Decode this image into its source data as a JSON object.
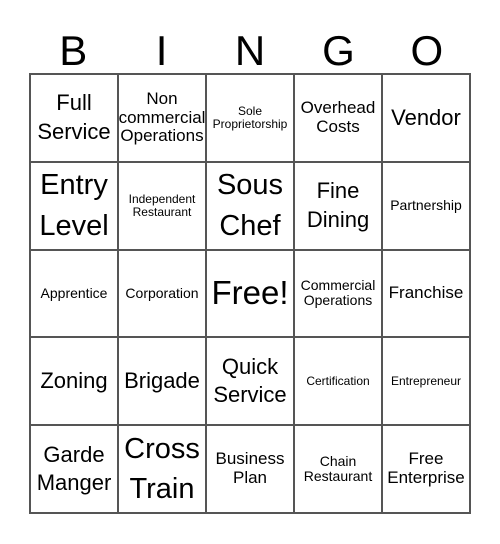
{
  "header": [
    "B",
    "I",
    "N",
    "G",
    "O"
  ],
  "cells": [
    {
      "text": "Full Service",
      "size": "s-lg"
    },
    {
      "text": "Non commercial Operations",
      "size": "s-md"
    },
    {
      "text": "Sole Proprietorship",
      "size": "s-xs"
    },
    {
      "text": "Overhead Costs",
      "size": "s-md"
    },
    {
      "text": "Vendor",
      "size": "s-lg"
    },
    {
      "text": "Entry Level",
      "size": "s-xl"
    },
    {
      "text": "Independent Restaurant",
      "size": "s-xs"
    },
    {
      "text": "Sous Chef",
      "size": "s-xl"
    },
    {
      "text": "Fine Dining",
      "size": "s-lg"
    },
    {
      "text": "Partnership",
      "size": "s-sm"
    },
    {
      "text": "Apprentice",
      "size": "s-sm"
    },
    {
      "text": "Corporation",
      "size": "s-sm"
    },
    {
      "text": "Free!",
      "size": "s-xxl"
    },
    {
      "text": "Commercial Operations",
      "size": "s-sm"
    },
    {
      "text": "Franchise",
      "size": "s-md"
    },
    {
      "text": "Zoning",
      "size": "s-lg"
    },
    {
      "text": "Brigade",
      "size": "s-lg"
    },
    {
      "text": "Quick Service",
      "size": "s-lg"
    },
    {
      "text": "Certification",
      "size": "s-xs"
    },
    {
      "text": "Entrepreneur",
      "size": "s-xs"
    },
    {
      "text": "Garde Manger",
      "size": "s-lg"
    },
    {
      "text": "Cross Train",
      "size": "s-xl"
    },
    {
      "text": "Business Plan",
      "size": "s-md"
    },
    {
      "text": "Chain Restaurant",
      "size": "s-sm"
    },
    {
      "text": "Free Enterprise",
      "size": "s-md"
    }
  ]
}
